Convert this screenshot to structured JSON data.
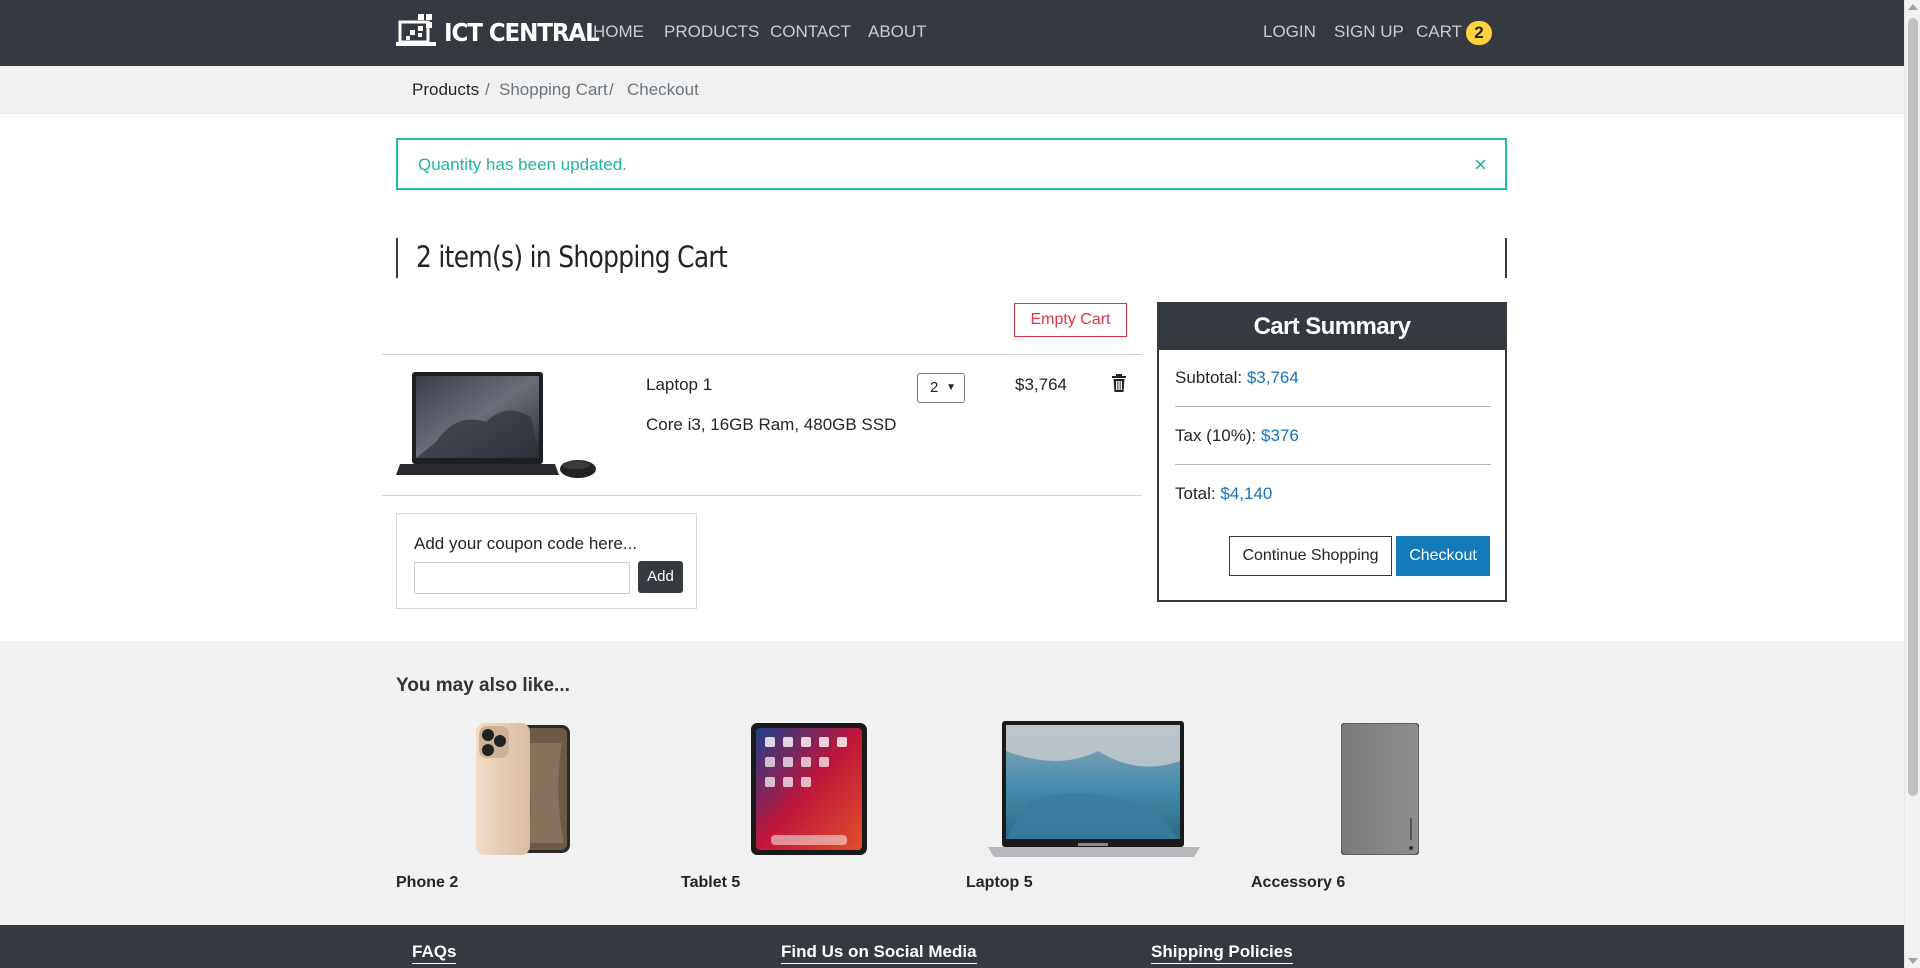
{
  "navbar": {
    "brand": "ICT CENTRAL",
    "links": [
      "HOME",
      "PRODUCTS",
      "CONTACT",
      "ABOUT"
    ],
    "login": "LOGIN",
    "signup": "SIGN UP",
    "cart": "CART",
    "cart_count": "2"
  },
  "breadcrumb": {
    "items": [
      "Products",
      "Shopping Cart",
      "Checkout"
    ],
    "separator": "/"
  },
  "alert": {
    "message": "Quantity has been updated.",
    "close": "×"
  },
  "cart": {
    "heading": "2 item(s) in Shopping Cart",
    "empty_button": "Empty Cart",
    "items": [
      {
        "name": "Laptop 1",
        "description": "Core i3, 16GB Ram, 480GB SSD",
        "quantity": "2",
        "price": "$3,764",
        "icon": "trash-icon"
      }
    ]
  },
  "coupon": {
    "label": "Add your coupon code here...",
    "input_value": "",
    "button": "Add"
  },
  "summary": {
    "title": "Cart Summary",
    "subtotal_label": "Subtotal:",
    "subtotal_value": "$3,764",
    "tax_label": "Tax (10%):",
    "tax_value": "$376",
    "total_label": "Total:",
    "total_value": "$4,140",
    "continue_button": "Continue Shopping",
    "checkout_button": "Checkout"
  },
  "recommendations": {
    "title": "You may also like...",
    "items": [
      {
        "name": "Phone 2"
      },
      {
        "name": "Tablet 5"
      },
      {
        "name": "Laptop 5"
      },
      {
        "name": "Accessory 6"
      }
    ]
  },
  "footer": {
    "links": [
      "FAQs",
      "Find Us on Social Media",
      "Shipping Policies"
    ]
  },
  "colors": {
    "navbar": "#343a40",
    "alert": "#20c0a8",
    "danger": "#dc3545",
    "primary": "#1479b8",
    "badge": "#ffd43b"
  }
}
